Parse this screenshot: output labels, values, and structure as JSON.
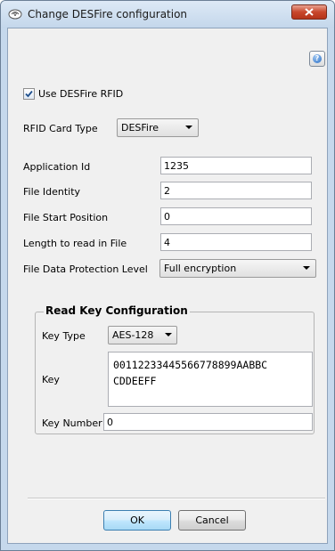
{
  "window": {
    "title": "Change DESFire configuration"
  },
  "main": {
    "use_rfid_label": "Use DESFire RFID",
    "use_rfid_checked": true,
    "card_type_label": "RFID Card Type",
    "card_type_value": "DESFire",
    "fields": [
      {
        "label": "Application Id",
        "value": "1235"
      },
      {
        "label": "File Identity",
        "value": "2"
      },
      {
        "label": "File Start Position",
        "value": "0"
      },
      {
        "label": "Length to read in File",
        "value": "4"
      }
    ],
    "protection_label": "File Data Protection Level",
    "protection_value": "Full encryption"
  },
  "read_key": {
    "group_title": "Read Key Configuration",
    "key_type_label": "Key Type",
    "key_type_value": "AES-128",
    "key_label": "Key",
    "key_line1": "00112233445566778899AABBC",
    "key_line2": "CDDEEFF",
    "key_number_label": "Key Number",
    "key_number_value": "0"
  },
  "buttons": {
    "ok": "OK",
    "cancel": "Cancel"
  },
  "colors": {
    "title_bar": "#c4d7eb",
    "close_button": "#c8472c",
    "dialog_bg": "#f0f0f0"
  }
}
